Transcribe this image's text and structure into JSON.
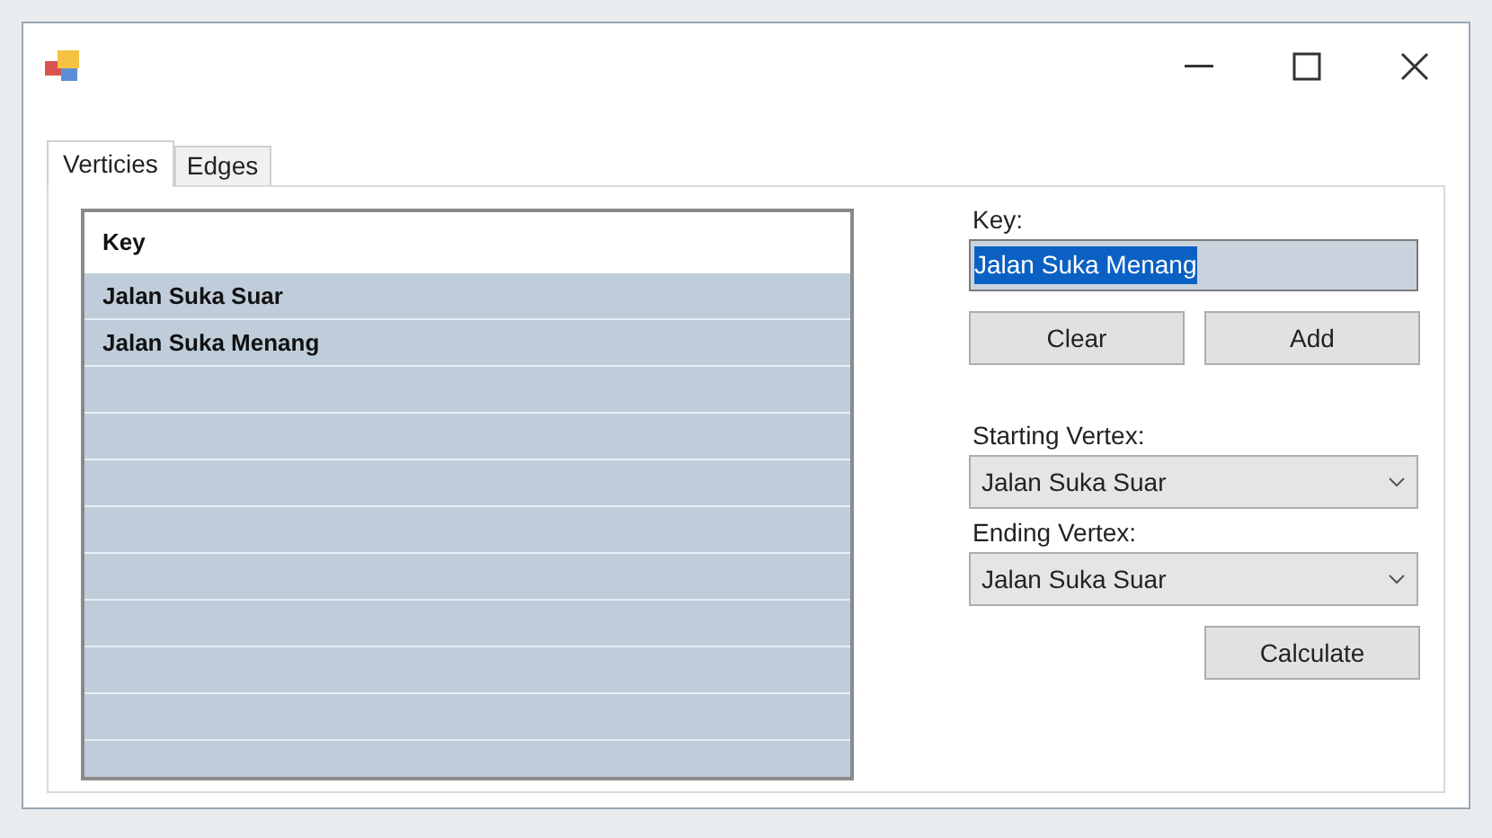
{
  "tabs": [
    {
      "label": "Verticies",
      "selected": true
    },
    {
      "label": "Edges",
      "selected": false
    }
  ],
  "list": {
    "header": "Key",
    "rows": [
      "Jalan Suka Suar",
      "Jalan Suka Menang"
    ]
  },
  "key_field": {
    "label": "Key:",
    "value": "Jalan Suka Menang",
    "text_selected": true
  },
  "buttons_row": [
    "Clear",
    "Add"
  ],
  "starting": {
    "label": "Starting Vertex:",
    "value": "Jalan Suka Suar"
  },
  "ending": {
    "label": "Ending Vertex:",
    "value": "Jalan Suka Suar"
  },
  "calculate": "Calculate"
}
